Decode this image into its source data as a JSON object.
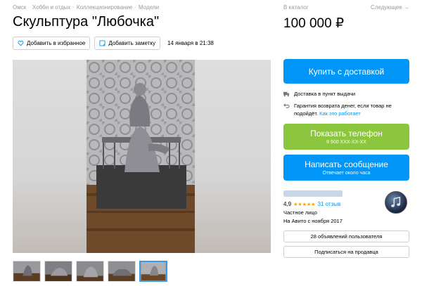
{
  "breadcrumbs": [
    "Омск",
    "Хобби и отдых",
    "Коллекционирование",
    "Модели"
  ],
  "title": "Скульптура \"Любочка\"",
  "actions": {
    "favorite_label": "Добавить в избранное",
    "note_label": "Добавить заметку",
    "posted": "14 января в 21:38"
  },
  "catalog_label": "В каталог",
  "next_label": "Следующее →",
  "price": "100 000 ₽",
  "buy_label": "Купить с доставкой",
  "delivery_text": "Доставка в пункт выдачи",
  "guarantee_text": "Гарантия возврата денег, если товар не подойдёт.",
  "guarantee_link": "Как это работает",
  "phone": {
    "label": "Показать телефон",
    "number": "8 900 XXX-XX-XX"
  },
  "message": {
    "label": "Написать сообщение",
    "sub": "Отвечает около часа"
  },
  "seller": {
    "rating": "4,9",
    "stars": "★★★★★",
    "reviews": "31 отзыв",
    "type": "Частное лицо",
    "since": "На Авито с ноября 2017",
    "ads_label": "28 объявлений пользователя",
    "subscribe_label": "Подписаться на продавца"
  },
  "colors": {
    "accent_blue": "#0096f7",
    "accent_green": "#8cc63f"
  },
  "gallery": {
    "thumbnail_count": 5,
    "active_thumbnail": 5
  }
}
